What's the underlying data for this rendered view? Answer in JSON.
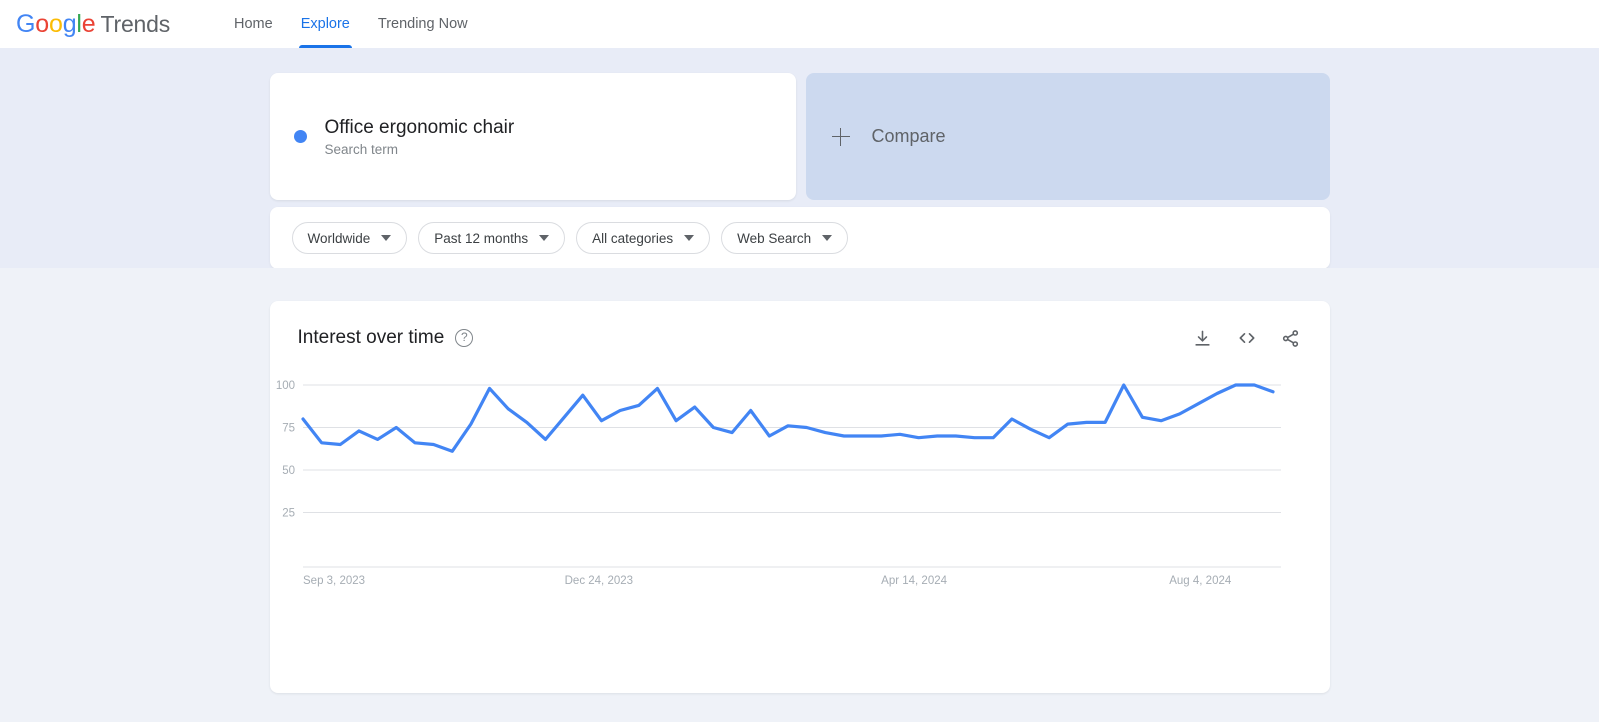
{
  "nav": {
    "brand_logo_letters": [
      "G",
      "o",
      "o",
      "g",
      "l",
      "e"
    ],
    "brand_word": "Trends",
    "items": [
      {
        "label": "Home",
        "active": false
      },
      {
        "label": "Explore",
        "active": true
      },
      {
        "label": "Trending Now",
        "active": false
      }
    ]
  },
  "search": {
    "term": "Office ergonomic chair",
    "type_label": "Search term",
    "dot_color": "#4285f4",
    "compare_label": "Compare",
    "compare_icon": "plus-icon"
  },
  "filters": [
    {
      "label": "Worldwide",
      "name": "location-filter"
    },
    {
      "label": "Past 12 months",
      "name": "time-filter"
    },
    {
      "label": "All categories",
      "name": "category-filter"
    },
    {
      "label": "Web Search",
      "name": "search-type-filter"
    }
  ],
  "chart_card": {
    "title": "Interest over time",
    "help_glyph": "?",
    "actions": [
      {
        "name": "download-icon",
        "label": "Download CSV"
      },
      {
        "name": "embed-code-icon",
        "label": "Embed"
      },
      {
        "name": "share-icon",
        "label": "Share"
      }
    ]
  },
  "chart_data": {
    "type": "line",
    "title": "Interest over time",
    "xlabel": "",
    "ylabel": "",
    "ylim": [
      0,
      100
    ],
    "yticks": [
      100,
      75,
      50,
      25
    ],
    "grid": true,
    "legend_position": "none",
    "line_color": "#4285f4",
    "xtick_labels": [
      "Sep 3, 2023",
      "Dec 24, 2023",
      "Apr 14, 2024",
      "Aug 4, 2024"
    ],
    "xtick_fractions": [
      0.0,
      0.305,
      0.63,
      0.925
    ],
    "series": [
      {
        "name": "Office ergonomic chair",
        "color": "#4285f4",
        "values": [
          80,
          66,
          65,
          73,
          68,
          75,
          66,
          65,
          61,
          77,
          98,
          86,
          78,
          68,
          81,
          94,
          79,
          85,
          88,
          98,
          79,
          87,
          75,
          72,
          85,
          70,
          76,
          75,
          72,
          70,
          70,
          70,
          71,
          69,
          70,
          70,
          69,
          69,
          80,
          74,
          69,
          77,
          78,
          78,
          100,
          81,
          79,
          83,
          89,
          95,
          100,
          100,
          96
        ]
      }
    ]
  }
}
